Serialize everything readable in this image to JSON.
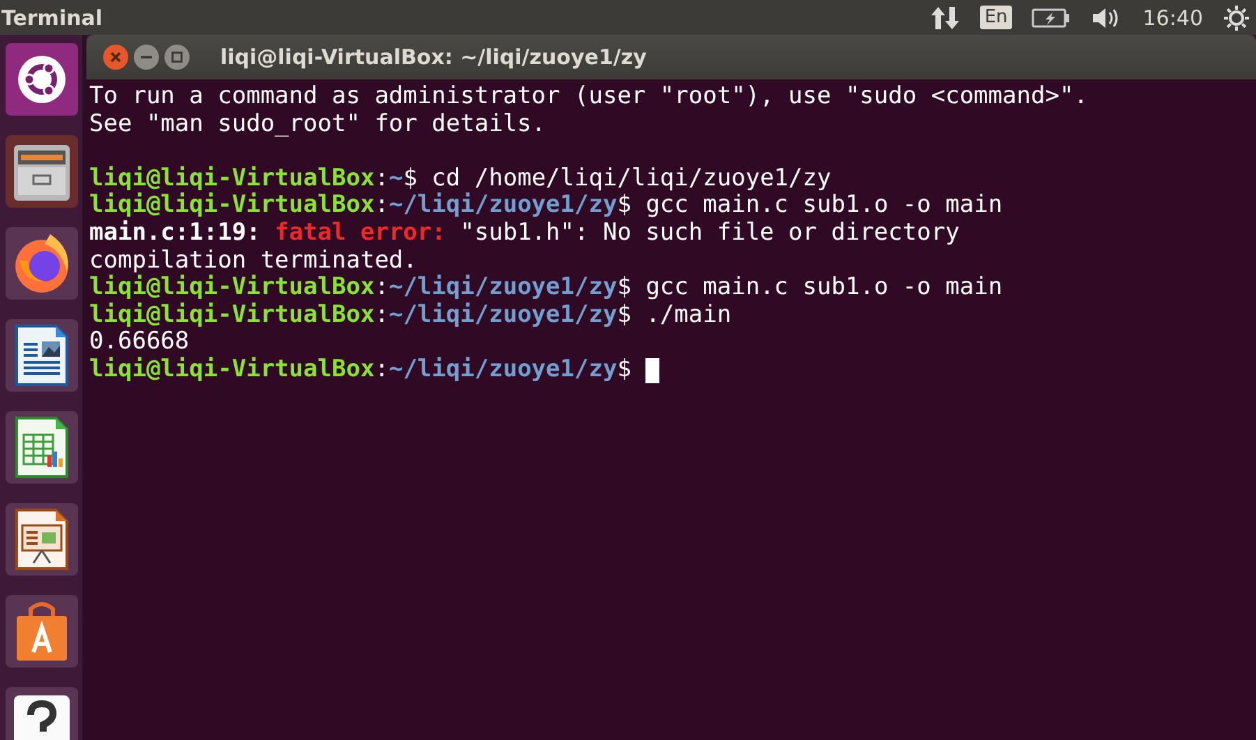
{
  "top_panel": {
    "app_name": "Terminal",
    "keyboard_layout": "En",
    "clock": "16:40"
  },
  "launcher": {
    "items": [
      {
        "kind": "ubuntu"
      },
      {
        "kind": "files"
      },
      {
        "kind": "firefox"
      },
      {
        "kind": "writer"
      },
      {
        "kind": "calc"
      },
      {
        "kind": "impress"
      },
      {
        "kind": "software"
      },
      {
        "kind": "help"
      }
    ]
  },
  "window": {
    "title": "liqi@liqi-VirtualBox: ~/liqi/zuoye1/zy"
  },
  "terminal": {
    "lines": [
      {
        "kind": "output",
        "segments": [
          {
            "kind": "text",
            "text": "To run a command as administrator (user \"root\"), use \"sudo <command>\"."
          }
        ]
      },
      {
        "kind": "output",
        "segments": [
          {
            "kind": "text",
            "text": "See \"man sudo_root\" for details."
          }
        ]
      },
      {
        "kind": "blank"
      },
      {
        "kind": "output",
        "segments": [
          {
            "kind": "user",
            "text": "liqi@liqi-VirtualBox"
          },
          {
            "kind": "text",
            "text": ":"
          },
          {
            "kind": "path",
            "text": "~"
          },
          {
            "kind": "text",
            "text": "$ cd /home/liqi/liqi/zuoye1/zy"
          }
        ]
      },
      {
        "kind": "output",
        "segments": [
          {
            "kind": "user",
            "text": "liqi@liqi-VirtualBox"
          },
          {
            "kind": "text",
            "text": ":"
          },
          {
            "kind": "path",
            "text": "~/liqi/zuoye1/zy"
          },
          {
            "kind": "text",
            "text": "$ gcc main.c sub1.o -o main"
          }
        ]
      },
      {
        "kind": "output",
        "segments": [
          {
            "kind": "bold",
            "text": "main.c:1:19: "
          },
          {
            "kind": "error",
            "text": "fatal error:"
          },
          {
            "kind": "text",
            "text": " \"sub1.h\": No such file or directory"
          }
        ]
      },
      {
        "kind": "output",
        "segments": [
          {
            "kind": "text",
            "text": "compilation terminated."
          }
        ]
      },
      {
        "kind": "output",
        "segments": [
          {
            "kind": "user",
            "text": "liqi@liqi-VirtualBox"
          },
          {
            "kind": "text",
            "text": ":"
          },
          {
            "kind": "path",
            "text": "~/liqi/zuoye1/zy"
          },
          {
            "kind": "text",
            "text": "$ gcc main.c sub1.o -o main"
          }
        ]
      },
      {
        "kind": "output",
        "segments": [
          {
            "kind": "user",
            "text": "liqi@liqi-VirtualBox"
          },
          {
            "kind": "text",
            "text": ":"
          },
          {
            "kind": "path",
            "text": "~/liqi/zuoye1/zy"
          },
          {
            "kind": "text",
            "text": "$ ./main"
          }
        ]
      },
      {
        "kind": "output",
        "segments": [
          {
            "kind": "text",
            "text": "0.66668"
          }
        ]
      },
      {
        "kind": "prompt",
        "segments": [
          {
            "kind": "user",
            "text": "liqi@liqi-VirtualBox"
          },
          {
            "kind": "text",
            "text": ":"
          },
          {
            "kind": "path",
            "text": "~/liqi/zuoye1/zy"
          },
          {
            "kind": "text",
            "text": "$"
          }
        ]
      }
    ]
  }
}
